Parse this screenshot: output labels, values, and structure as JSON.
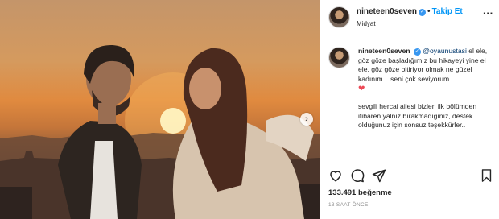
{
  "post": {
    "photo_alt": "Couple facing each other at sunset over a city",
    "carousel_next_glyph": "›"
  },
  "header": {
    "username": "nineteen0seven",
    "verified_glyph": "✓",
    "separator": "•",
    "follow_label": "Takip Et",
    "location": "Midyat",
    "more_glyph": "···"
  },
  "caption": {
    "username": "nineteen0seven",
    "mention": "@oyaunustasi",
    "text_part1": " el ele, göz göze başladığımız bu hikayeyi yine el ele, göz göze bitiriyor olmak ne güzel kadınım... seni çok seviyorum",
    "heart_glyph": "❤",
    "text_part2": "sevgili hercai ailesi bizleri ilk bölümden itibaren yalnız bırakmadığınız, destek olduğunuz için sonsuz teşekkürler..",
    "text_cutoff": "…"
  },
  "actions": {
    "likes_label": "133.491 beğenme",
    "timestamp": "13 SAAT ÖNCE"
  },
  "colors": {
    "accent": "#0095f6",
    "verified": "#3897f0",
    "heart": "#ed4956",
    "text": "#262626",
    "muted": "#8e8e8e",
    "divider": "#efefef"
  },
  "icons": {
    "like": "heart-icon",
    "comment": "comment-icon",
    "share": "share-icon",
    "save": "bookmark-icon",
    "more": "more-options-icon",
    "verified": "verified-badge-icon",
    "carousel": "chevron-right-icon"
  }
}
